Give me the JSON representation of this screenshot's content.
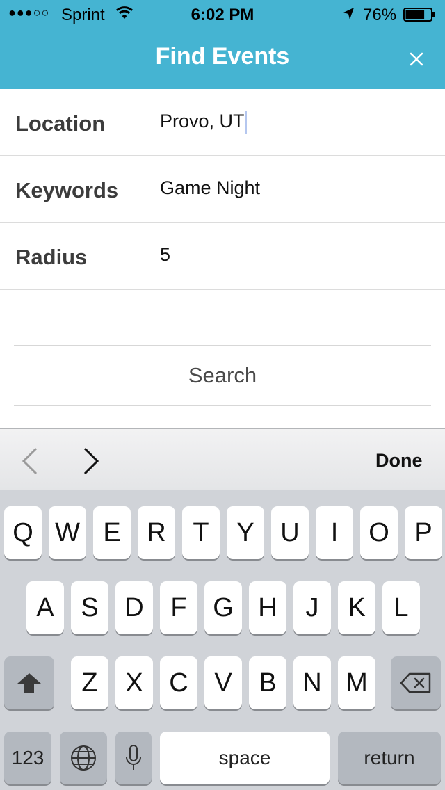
{
  "status_bar": {
    "signal": "●●●○○",
    "carrier": "Sprint",
    "time": "6:02 PM",
    "battery_percent": "76%",
    "battery_level": 0.76
  },
  "nav": {
    "title": "Find Events",
    "close_icon": "close-icon"
  },
  "form": {
    "location": {
      "label": "Location",
      "value": "Provo, UT"
    },
    "keywords": {
      "label": "Keywords",
      "value": "Game Night"
    },
    "radius": {
      "label": "Radius",
      "value": "5"
    }
  },
  "search_button": "Search",
  "toolbar": {
    "prev_icon": "chevron-left-icon",
    "next_icon": "chevron-right-icon",
    "done_label": "Done"
  },
  "keyboard": {
    "row1": [
      "Q",
      "W",
      "E",
      "R",
      "T",
      "Y",
      "U",
      "I",
      "O",
      "P"
    ],
    "row2": [
      "A",
      "S",
      "D",
      "F",
      "G",
      "H",
      "J",
      "K",
      "L"
    ],
    "row3": [
      "Z",
      "X",
      "C",
      "V",
      "B",
      "N",
      "M"
    ],
    "numbers_label": "123",
    "space_label": "space",
    "return_label": "return",
    "shift_icon": "shift-icon",
    "backspace_icon": "backspace-icon",
    "globe_icon": "globe-icon",
    "mic_icon": "microphone-icon"
  },
  "colors": {
    "header": "#45b4d2",
    "keyboard_bg": "#d0d3d8",
    "key": "#ffffff",
    "key_dark": "#b3b8bf"
  }
}
